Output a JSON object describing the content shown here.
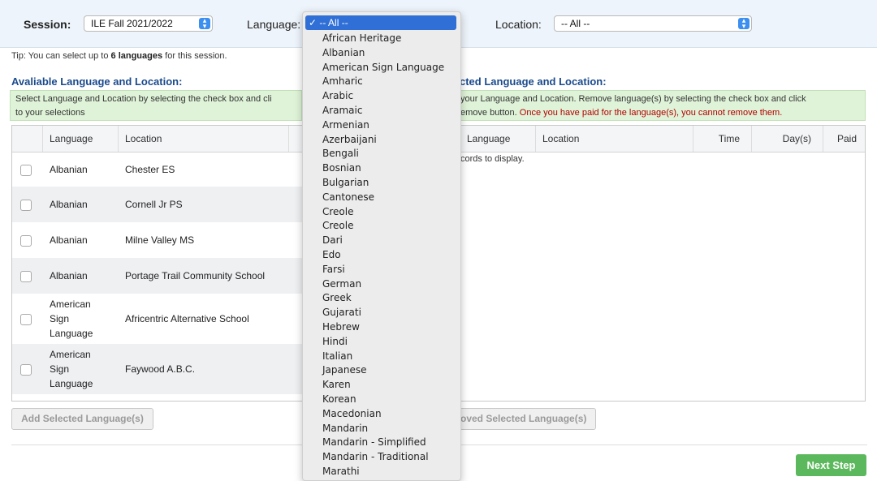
{
  "session": {
    "label": "Session:",
    "value": "ILE Fall 2021/2022"
  },
  "language": {
    "label": "Language:",
    "value": "-- All --"
  },
  "location": {
    "label": "Location:",
    "value": "-- All --"
  },
  "tip": {
    "prefix": "Tip: You can select up to ",
    "bold": "6 languages",
    "suffix": " for this session."
  },
  "available": {
    "heading": "Avaliable Language and Location:",
    "info": "Select Language and Location by selecting the check box and cli",
    "info2": "to your selections",
    "columns": [
      "Language",
      "Location"
    ],
    "rows": [
      {
        "language": "Albanian",
        "location": "Chester ES"
      },
      {
        "language": "Albanian",
        "location": "Cornell Jr PS"
      },
      {
        "language": "Albanian",
        "location": "Milne Valley MS"
      },
      {
        "language": "Albanian",
        "location": "Portage Trail Community School"
      },
      {
        "language": "American Sign Language",
        "location": "Africentric Alternative School"
      },
      {
        "language": "American Sign Language",
        "location": "Faywood A.B.C."
      }
    ],
    "add_button": "Add Selected Language(s)"
  },
  "selected": {
    "heading": "cted Language and Location:",
    "info1": " your Language and Location. Remove language(s) by selecting the check box and click",
    "info2_plain": "emove button. ",
    "info2_red": "Once you have paid for the language(s), you cannot remove them.",
    "columns": [
      "Language",
      "Location",
      "Time",
      "Day(s)",
      "Paid"
    ],
    "empty": "cords to display.",
    "remove_button": "oved Selected Language(s)"
  },
  "next_button": "Next Step",
  "dropdown": {
    "selected": "✓  -- All --",
    "items": [
      "African Heritage",
      "Albanian",
      "American Sign Language",
      "Amharic",
      "Arabic",
      "Aramaic",
      "Armenian",
      "Azerbaijani",
      "Bengali",
      "Bosnian",
      "Bulgarian",
      "Cantonese",
      "Creole",
      "Creole",
      "Dari",
      "Edo",
      "Farsi",
      "German",
      "Greek",
      "Gujarati",
      "Hebrew",
      "Hindi",
      "Italian",
      "Japanese",
      "Karen",
      "Korean",
      "Macedonian",
      "Mandarin",
      "Mandarin - Simplified",
      "Mandarin - Traditional",
      "Marathi"
    ]
  }
}
